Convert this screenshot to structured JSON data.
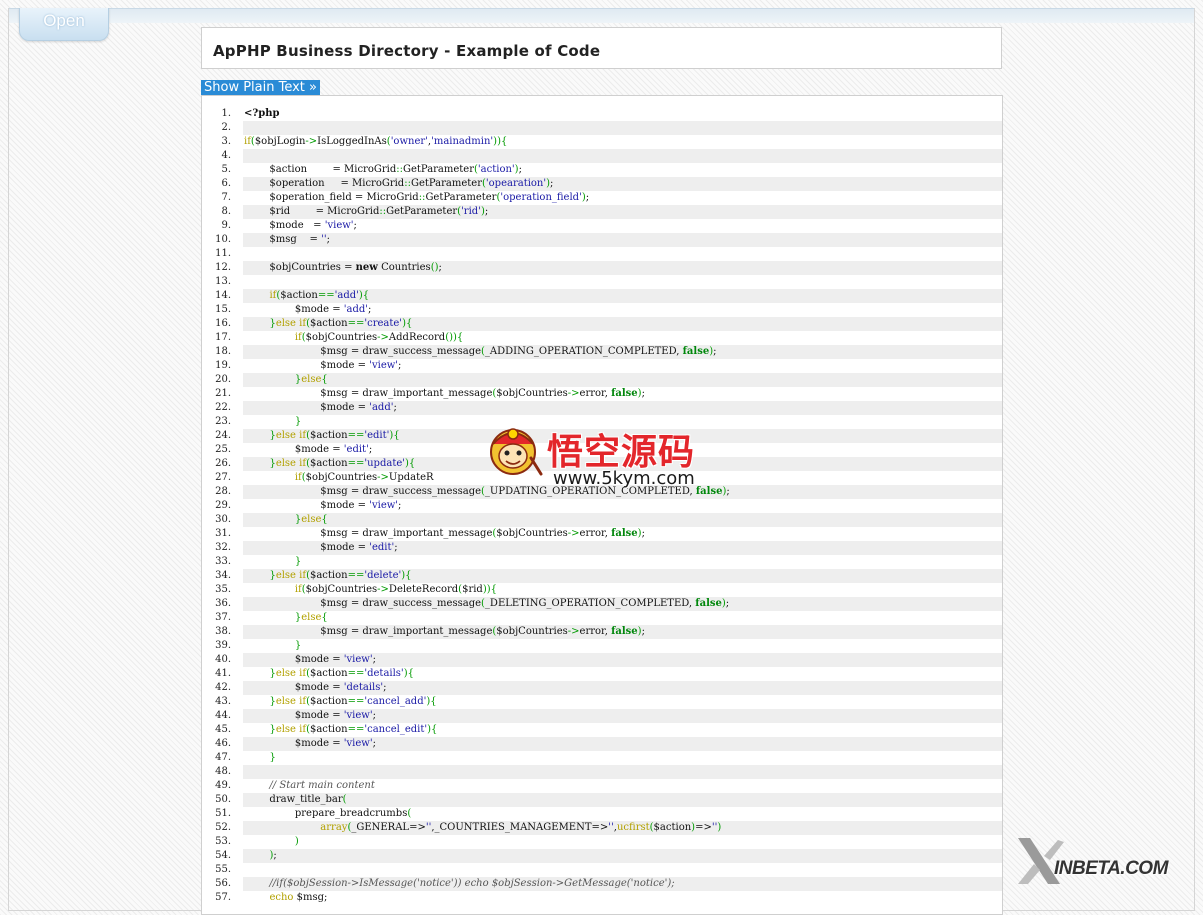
{
  "header": {
    "open_tab_label": "Open"
  },
  "page": {
    "title": "ApPHP Business Directory - Example of Code",
    "show_plain_text_label": "Show Plain Text »"
  },
  "watermark": {
    "chinese_title": "悟空源码",
    "url": "www.5kym.com"
  },
  "logo": {
    "text": "INBETA.COM"
  },
  "code": {
    "lines": [
      {
        "n": "1.",
        "text": "<?php"
      },
      {
        "n": "2.",
        "text": ""
      },
      {
        "n": "3.",
        "text": "if($objLogin->IsLoggedInAs('owner','mainadmin')){"
      },
      {
        "n": "4.",
        "text": ""
      },
      {
        "n": "5.",
        "text": "        $action        = MicroGrid::GetParameter('action');"
      },
      {
        "n": "6.",
        "text": "        $operation     = MicroGrid::GetParameter('opearation');"
      },
      {
        "n": "7.",
        "text": "        $operation_field = MicroGrid::GetParameter('operation_field');"
      },
      {
        "n": "8.",
        "text": "        $rid        = MicroGrid::GetParameter('rid');"
      },
      {
        "n": "9.",
        "text": "        $mode   = 'view';"
      },
      {
        "n": "10.",
        "text": "        $msg    = '';"
      },
      {
        "n": "11.",
        "text": ""
      },
      {
        "n": "12.",
        "text": "        $objCountries = new Countries();"
      },
      {
        "n": "13.",
        "text": ""
      },
      {
        "n": "14.",
        "text": "        if($action=='add'){"
      },
      {
        "n": "15.",
        "text": "                $mode = 'add';"
      },
      {
        "n": "16.",
        "text": "        }else if($action=='create'){"
      },
      {
        "n": "17.",
        "text": "                if($objCountries->AddRecord()){"
      },
      {
        "n": "18.",
        "text": "                        $msg = draw_success_message(_ADDING_OPERATION_COMPLETED, false);"
      },
      {
        "n": "19.",
        "text": "                        $mode = 'view';"
      },
      {
        "n": "20.",
        "text": "                }else{"
      },
      {
        "n": "21.",
        "text": "                        $msg = draw_important_message($objCountries->error, false);"
      },
      {
        "n": "22.",
        "text": "                        $mode = 'add';"
      },
      {
        "n": "23.",
        "text": "                }"
      },
      {
        "n": "24.",
        "text": "        }else if($action=='edit'){"
      },
      {
        "n": "25.",
        "text": "                $mode = 'edit';"
      },
      {
        "n": "26.",
        "text": "        }else if($action=='update'){"
      },
      {
        "n": "27.",
        "text": "                if($objCountries->UpdateR"
      },
      {
        "n": "28.",
        "text": "                        $msg = draw_success_message(_UPDATING_OPERATION_COMPLETED, false);"
      },
      {
        "n": "29.",
        "text": "                        $mode = 'view';"
      },
      {
        "n": "30.",
        "text": "                }else{"
      },
      {
        "n": "31.",
        "text": "                        $msg = draw_important_message($objCountries->error, false);"
      },
      {
        "n": "32.",
        "text": "                        $mode = 'edit';"
      },
      {
        "n": "33.",
        "text": "                }"
      },
      {
        "n": "34.",
        "text": "        }else if($action=='delete'){"
      },
      {
        "n": "35.",
        "text": "                if($objCountries->DeleteRecord($rid)){"
      },
      {
        "n": "36.",
        "text": "                        $msg = draw_success_message(_DELETING_OPERATION_COMPLETED, false);"
      },
      {
        "n": "37.",
        "text": "                }else{"
      },
      {
        "n": "38.",
        "text": "                        $msg = draw_important_message($objCountries->error, false);"
      },
      {
        "n": "39.",
        "text": "                }"
      },
      {
        "n": "40.",
        "text": "                $mode = 'view';"
      },
      {
        "n": "41.",
        "text": "        }else if($action=='details'){"
      },
      {
        "n": "42.",
        "text": "                $mode = 'details';"
      },
      {
        "n": "43.",
        "text": "        }else if($action=='cancel_add'){"
      },
      {
        "n": "44.",
        "text": "                $mode = 'view';"
      },
      {
        "n": "45.",
        "text": "        }else if($action=='cancel_edit'){"
      },
      {
        "n": "46.",
        "text": "                $mode = 'view';"
      },
      {
        "n": "47.",
        "text": "        }"
      },
      {
        "n": "48.",
        "text": ""
      },
      {
        "n": "49.",
        "text": "        // Start main content"
      },
      {
        "n": "50.",
        "text": "        draw_title_bar("
      },
      {
        "n": "51.",
        "text": "                prepare_breadcrumbs("
      },
      {
        "n": "52.",
        "text": "                        array(_GENERAL=>'',_COUNTRIES_MANAGEMENT=>'',ucfirst($action)=>'')"
      },
      {
        "n": "53.",
        "text": "                )"
      },
      {
        "n": "54.",
        "text": "        );"
      },
      {
        "n": "55.",
        "text": ""
      },
      {
        "n": "56.",
        "text": "        //if($objSession->IsMessage('notice')) echo $objSession->GetMessage('notice');"
      },
      {
        "n": "57.",
        "text": "        echo $msg;"
      }
    ]
  }
}
